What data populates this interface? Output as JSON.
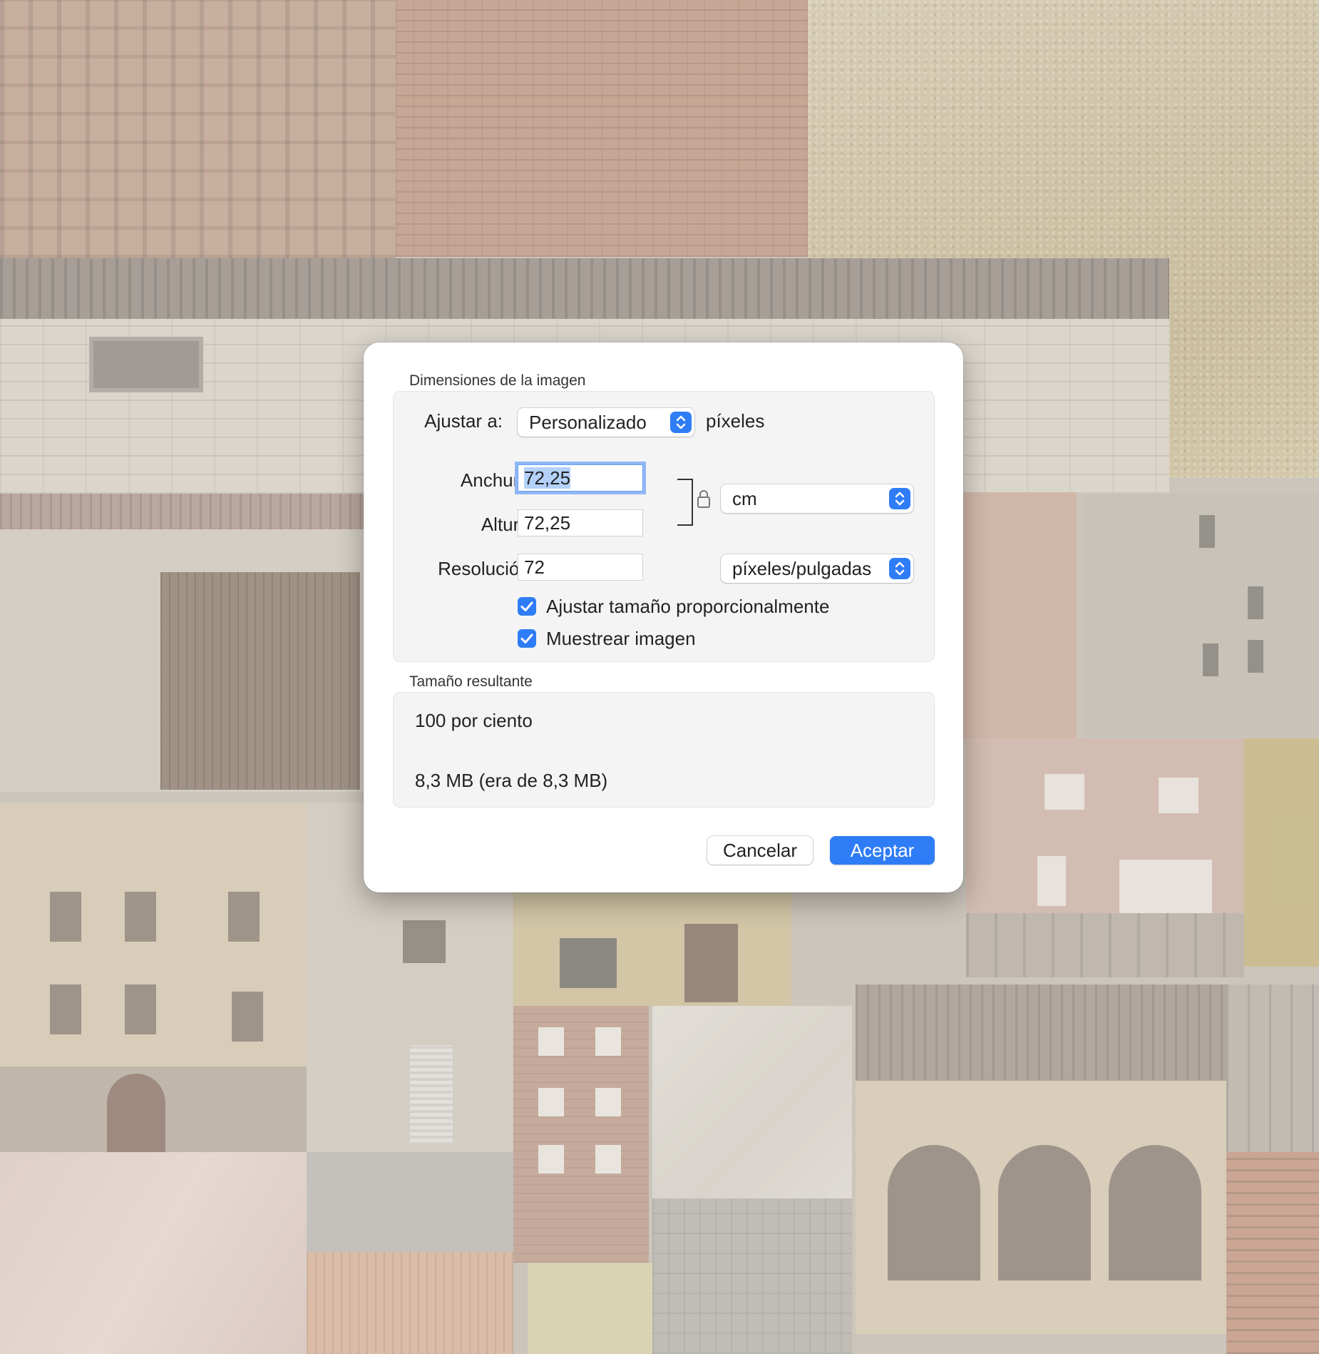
{
  "dialog": {
    "image_dimensions_title": "Dimensiones de la imagen",
    "fit_label": "Ajustar a:",
    "fit_value": "Personalizado",
    "fit_unit": "píxeles",
    "width_label": "Anchura:",
    "width_value": "72,25",
    "height_label": "Altura:",
    "height_value": "72,25",
    "resolution_label": "Resolución:",
    "resolution_value": "72",
    "size_unit": "cm",
    "resolution_unit": "píxeles/pulgadas",
    "scale_proportionally_label": "Ajustar tamaño proporcionalmente",
    "scale_proportionally_checked": true,
    "resample_label": "Muestrear imagen",
    "resample_checked": true,
    "result_title": "Tamaño resultante",
    "result_percent": "100 por ciento",
    "result_size": "8,3 MB (era de 8,3 MB)",
    "cancel_label": "Cancelar",
    "ok_label": "Aceptar"
  },
  "colors": {
    "accent": "#2f7df6",
    "focus_ring": "#8fb7f5"
  },
  "icons": [
    "lock-icon",
    "stepper-updown-icon",
    "checkmark-icon"
  ]
}
